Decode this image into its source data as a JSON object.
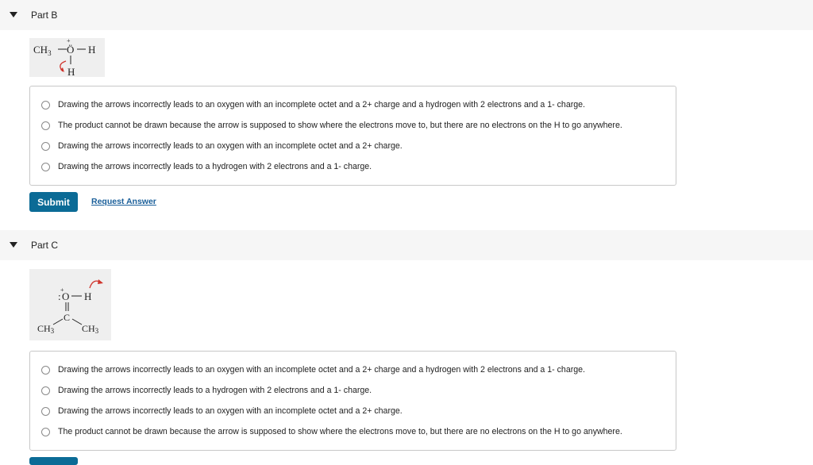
{
  "partB": {
    "title": "Part B",
    "choices": [
      "Drawing the arrows incorrectly leads to an oxygen with an incomplete octet and a 2+ charge and a hydrogen with 2 electrons and a 1- charge.",
      "The product cannot be drawn because the arrow is supposed to show where the electrons move to, but there are no electrons on the H to go anywhere.",
      "Drawing the arrows incorrectly leads to an oxygen with an incomplete octet and a 2+ charge.",
      "Drawing the arrows incorrectly leads to a hydrogen with 2 electrons and a 1- charge."
    ],
    "submit_label": "Submit",
    "request_label": "Request Answer",
    "molecule": {
      "ch3": "CH",
      "sub3": "3",
      "bond1": "—",
      "oxygen": "Ö",
      "plus": "+",
      "bond2": "—",
      "h_right": "H",
      "h_bottom": "H"
    }
  },
  "partC": {
    "title": "Part C",
    "choices": [
      "Drawing the arrows incorrectly leads to an oxygen with an incomplete octet and a 2+ charge and a hydrogen with 2 electrons and a 1- charge.",
      "Drawing the arrows incorrectly leads to a hydrogen with 2 electrons and a 1- charge.",
      "Drawing the arrows incorrectly leads to an oxygen with an incomplete octet and a 2+ charge.",
      "The product cannot be drawn because the arrow is supposed to show where the electrons move to, but there are no electrons on the H to go anywhere."
    ],
    "molecule": {
      "oxygen": "O",
      "plus": "+",
      "h": "H",
      "carbon": "C",
      "ch3_left": "CH",
      "ch3_right": "CH",
      "sub3": "3"
    }
  },
  "colors": {
    "arrow": "#d0342c",
    "submit_bg": "#0b6b96",
    "link": "#1a5f9a"
  }
}
